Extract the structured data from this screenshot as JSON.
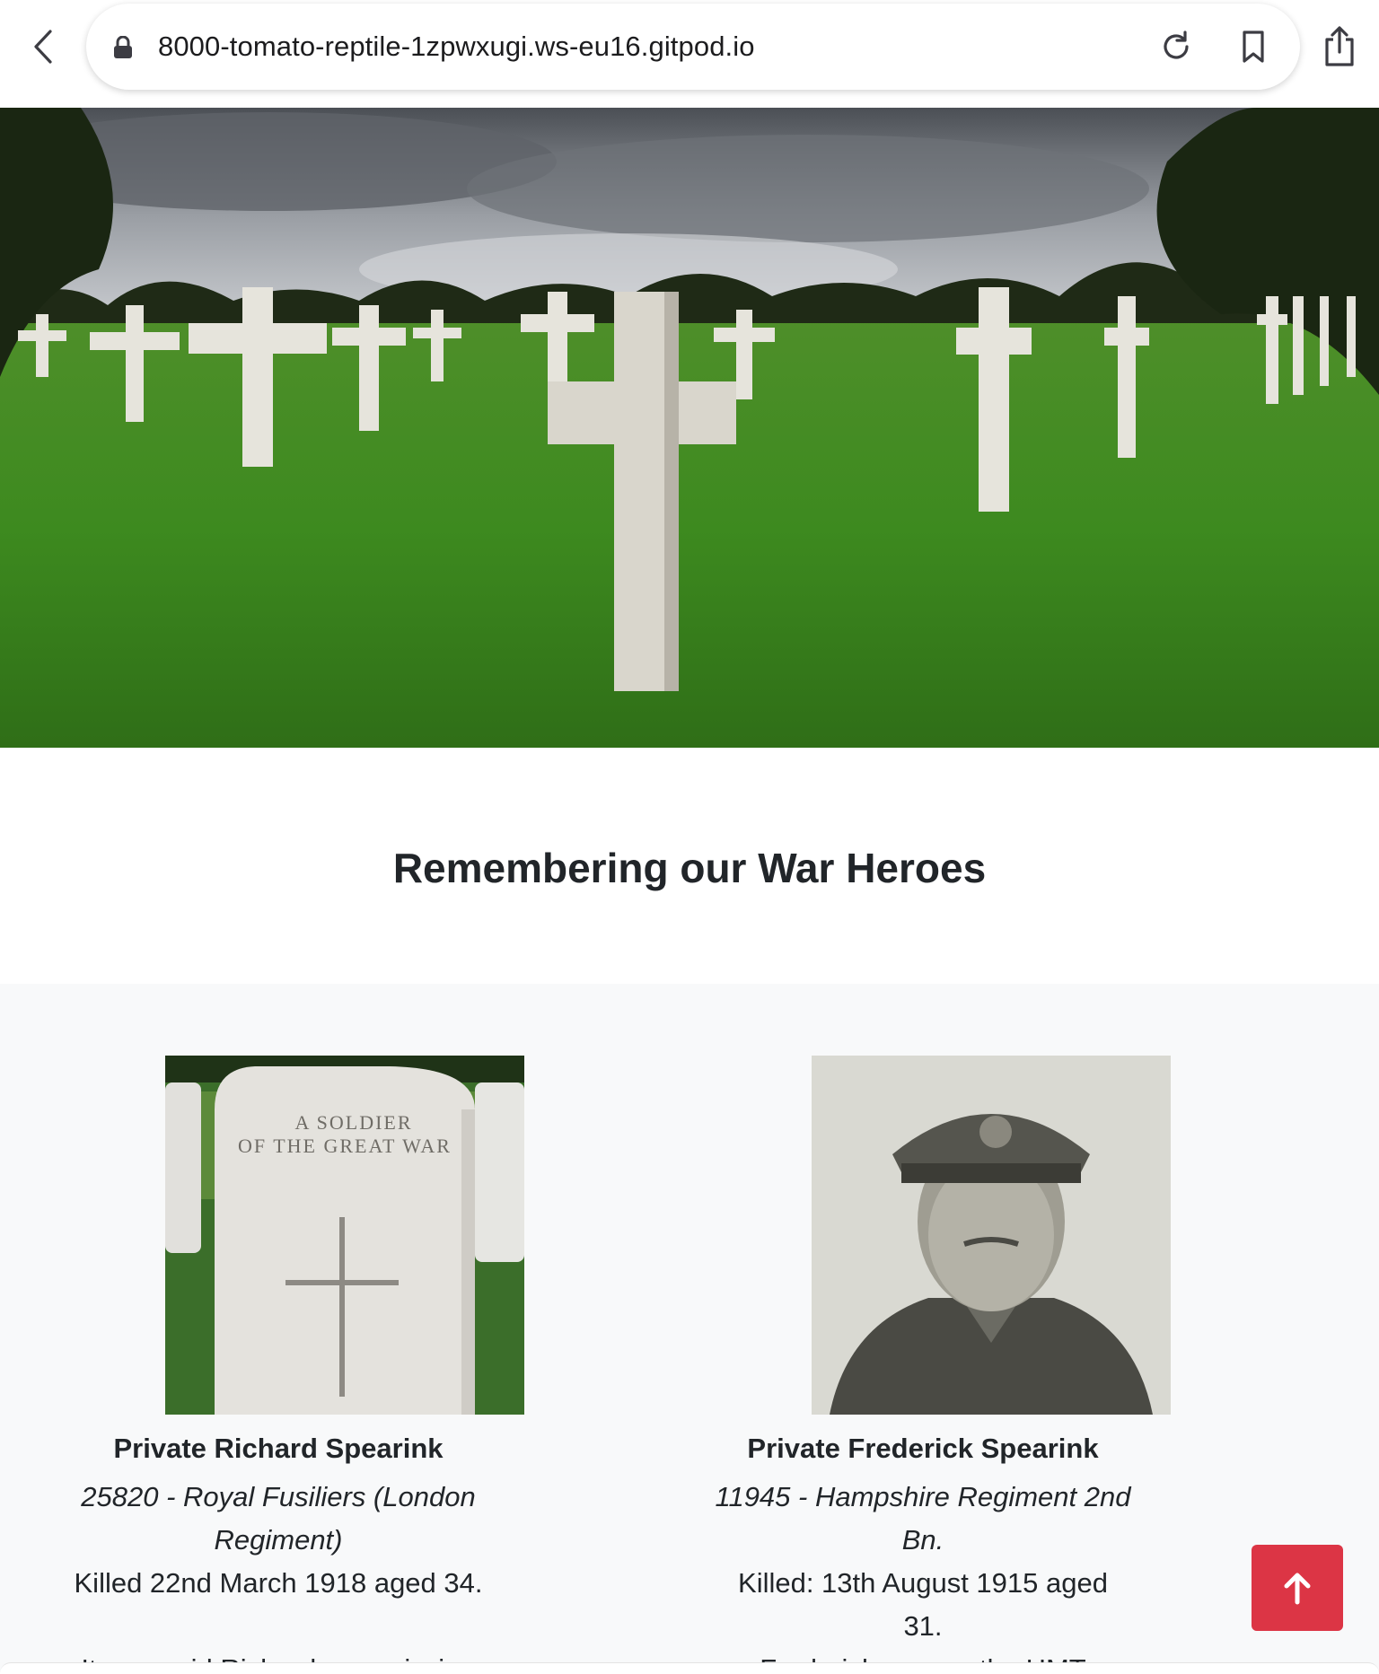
{
  "browser": {
    "url": "8000-tomato-reptile-1zpwxugi.ws-eu16.gitpod.io"
  },
  "page": {
    "heading": "Remembering our War Heroes"
  },
  "heroes": [
    {
      "name": "Private Richard Spearink",
      "detail": "25820 - Royal Fusiliers (London Regiment)",
      "killed": "Killed 22nd March 1918 aged 34.",
      "teaser": "It was said Richard was missing",
      "headstone_line1": "A SOLDIER",
      "headstone_line2": "OF THE GREAT WAR"
    },
    {
      "name": "Private Frederick Spearink",
      "detail": "11945 - Hampshire Regiment 2nd Bn.",
      "killed": "Killed: 13th August 1915 aged 31.",
      "teaser": "Frederick was on the HMT"
    }
  ],
  "icons": {
    "back": "chevron-left-icon",
    "lock": "lock-icon",
    "reload": "reload-icon",
    "bookmark": "bookmark-icon",
    "share": "share-icon",
    "to_top": "arrow-up-icon"
  },
  "colors": {
    "accent": "#dc3545",
    "section_bg": "#f8f9fa"
  }
}
